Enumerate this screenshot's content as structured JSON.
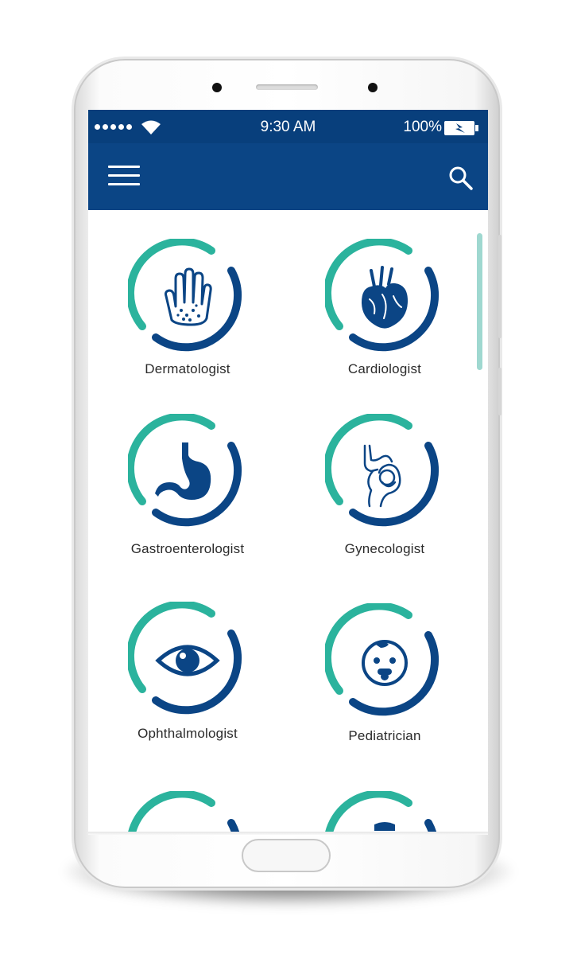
{
  "status_bar": {
    "time": "9:30 AM",
    "battery_percent": "100%",
    "signal_icon": "signal-dots-icon",
    "wifi_icon": "wifi-icon",
    "battery_icon": "battery-charging-icon"
  },
  "app_bar": {
    "menu_icon": "hamburger-menu-icon",
    "search_icon": "search-icon"
  },
  "specialties": [
    {
      "label": "Dermatologist",
      "icon": "hand-icon"
    },
    {
      "label": "Cardiologist",
      "icon": "heart-icon"
    },
    {
      "label": "Gastroenterologist",
      "icon": "stomach-icon"
    },
    {
      "label": "Gynecologist",
      "icon": "pregnancy-icon"
    },
    {
      "label": "Ophthalmologist",
      "icon": "eye-icon"
    },
    {
      "label": "Pediatrician",
      "icon": "baby-icon"
    }
  ],
  "colors": {
    "primary_blue": "#0b4585",
    "status_blue": "#083f7c",
    "teal_accent": "#2bb39d",
    "scrollbar": "#9fd8d0"
  }
}
